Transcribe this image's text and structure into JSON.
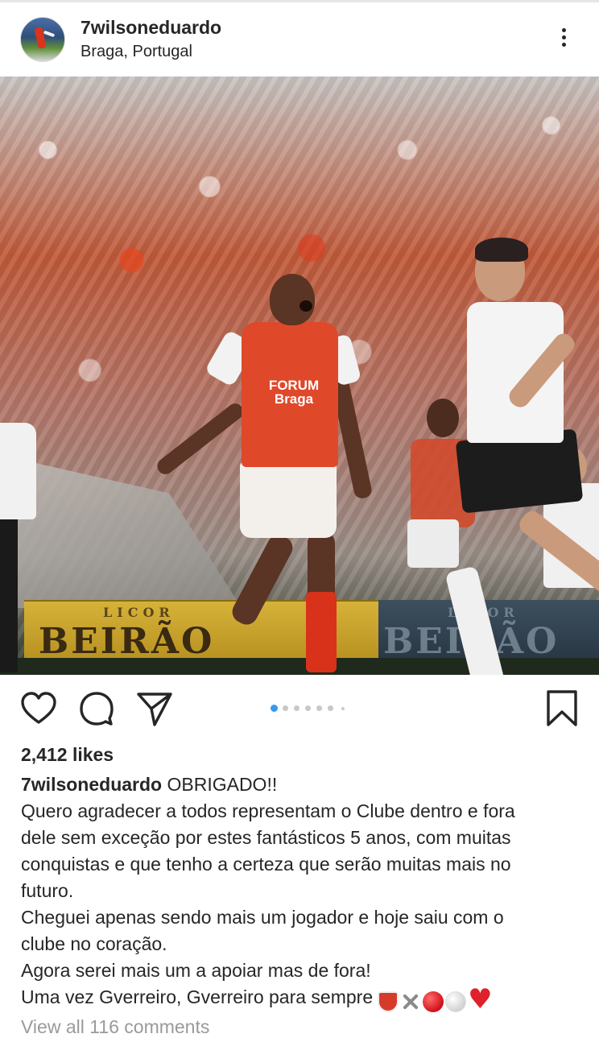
{
  "post": {
    "username": "7wilsoneduardo",
    "location": "Braga, Portugal"
  },
  "photo": {
    "sponsor_line1": "FORUM",
    "sponsor_line2": "Braga",
    "board_small": "LICOR",
    "board_large": "BEIRÃO",
    "board2_small": "LICOR",
    "board2_large": "BEIRÃO"
  },
  "carousel": {
    "count": 7,
    "active_index": 0
  },
  "likes": "2,412 likes",
  "caption": {
    "username": "7wilsoneduardo",
    "lines": [
      "OBRIGADO!!",
      "Quero agradecer a todos representam o Clube dentro e fora",
      "dele sem exceção por estes fantásticos 5 anos, com muitas",
      "conquistas e que tenho a certeza que serão muitas mais no",
      "futuro.",
      "Cheguei apenas sendo mais um jogador e hoje saiu com o",
      "clube no coração.",
      "Agora serei mais um a apoiar mas de fora!",
      "Uma vez Gverreiro, Gverreiro para sempre"
    ],
    "emojis": [
      "shield-emoji",
      "crossed-swords-emoji",
      "red-circle-emoji",
      "white-circle-emoji",
      "red-heart-emoji"
    ]
  },
  "view_comments": "View all 116 comments",
  "colors": {
    "accent": "#3897f0",
    "text": "#262626",
    "muted": "#9a9a9a"
  }
}
